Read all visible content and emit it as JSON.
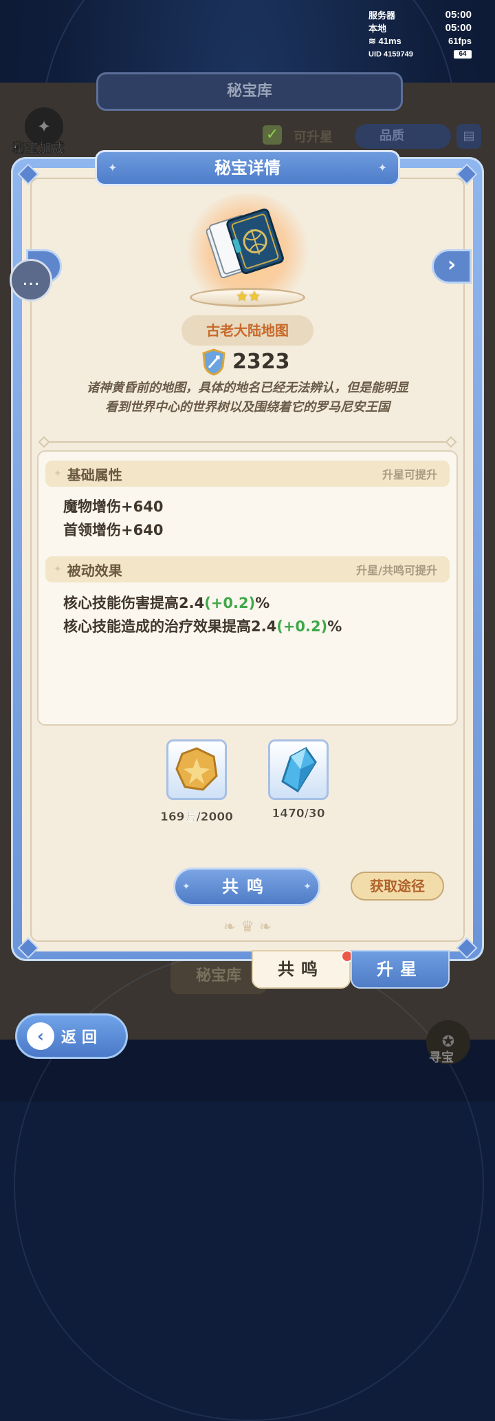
{
  "status": {
    "server_label": "服务器",
    "server_time": "05:00",
    "local_label": "本地",
    "local_time": "05:00",
    "ping": "41ms",
    "fps": "61fps",
    "uid_label": "UID",
    "uid": "4159749",
    "battery": "64"
  },
  "background": {
    "title": "秘宝库",
    "bonus_label": "秘宝加成",
    "upgradable_filter": "可升星",
    "quality_sort": "品质",
    "bottom_tab": "秘宝库",
    "treasure_label": "寻宝"
  },
  "back_button": "返回",
  "modal": {
    "title": "秘宝详情",
    "item_name": "古老大陆地图",
    "power": "2323",
    "description_line1": "诸神黄昏前的地图，具体的地名已经无法辨认，但是能明显",
    "description_line2": "看到世界中心的世界树以及围绕着它的罗马尼安王国",
    "basic_section": {
      "title": "基础属性",
      "hint": "升星可提升",
      "lines": [
        "魔物增伤+640",
        "首领增伤+640"
      ]
    },
    "passive_section": {
      "title": "被动效果",
      "hint": "升星/共鸣可提升",
      "lines": [
        {
          "text": "核心技能伤害提高2.4",
          "bonus": "(+0.2)",
          "suffix": "%"
        },
        {
          "text": "核心技能造成的治疗效果提高2.4",
          "bonus": "(+0.2)",
          "suffix": "%"
        }
      ]
    },
    "materials": [
      {
        "icon": "gold-coin-icon",
        "count": "169万/2000"
      },
      {
        "icon": "blue-crystal-icon",
        "count": "1470/30"
      }
    ],
    "resonate_button": "共鸣",
    "obtain_button": "获取途径",
    "stars": "★★"
  },
  "tabs": {
    "resonate": "共鸣",
    "upgrade": "升星"
  },
  "colors": {
    "accent_blue": "#5d86cd",
    "panel_cream": "#f4ecdd",
    "bonus_green": "#3fa84a",
    "name_orange": "#c7692a"
  }
}
